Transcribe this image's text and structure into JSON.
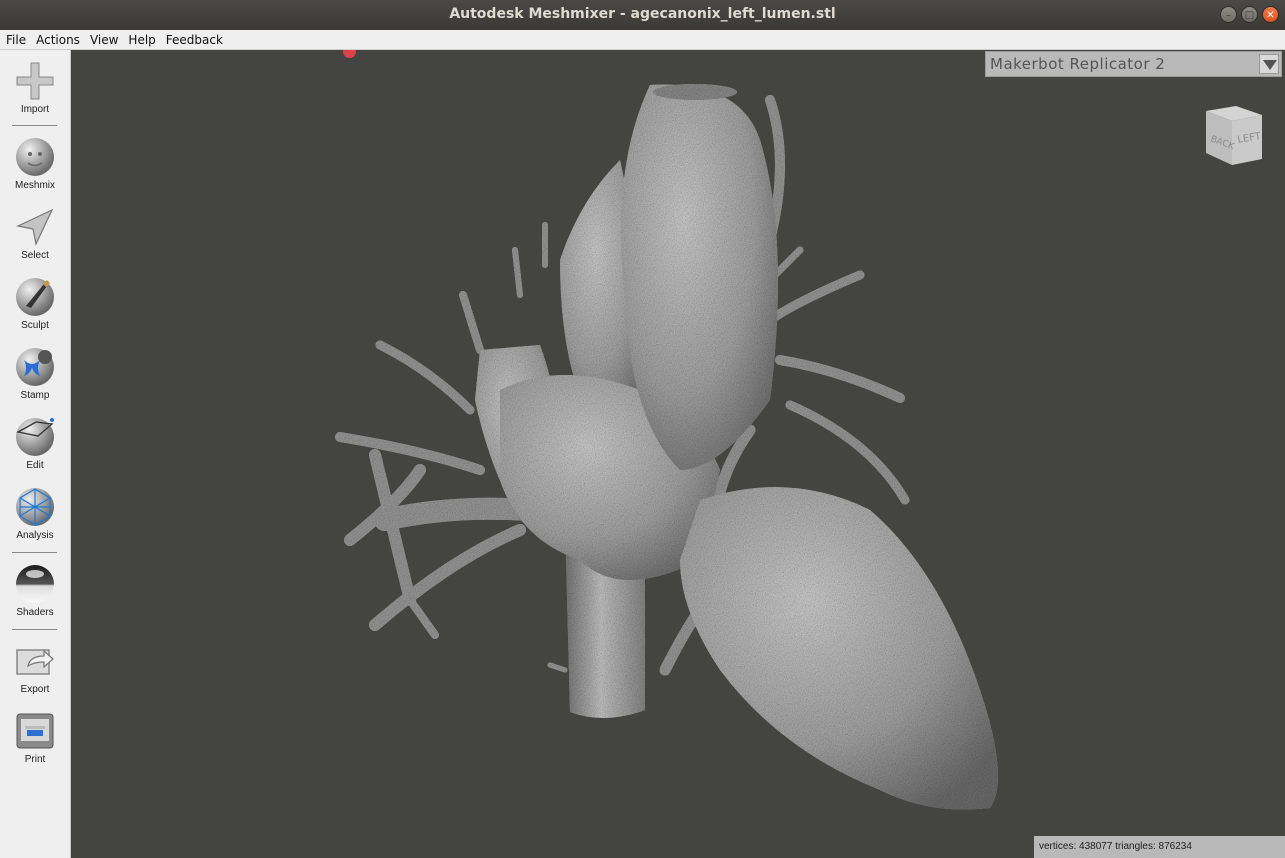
{
  "window": {
    "title": "Autodesk Meshmixer - agecanonix_left_lumen.stl",
    "controls": [
      "minimize",
      "maximize",
      "close"
    ]
  },
  "menu": [
    "File",
    "Actions",
    "View",
    "Help",
    "Feedback"
  ],
  "toolbar": {
    "tools": [
      {
        "label": "Import",
        "icon": "plus-icon"
      },
      {
        "label": "Meshmix",
        "icon": "meshmix-ball-icon"
      },
      {
        "label": "Select",
        "icon": "cursor-arrow-icon"
      },
      {
        "label": "Sculpt",
        "icon": "brush-ball-icon"
      },
      {
        "label": "Stamp",
        "icon": "stamp-ball-icon"
      },
      {
        "label": "Edit",
        "icon": "edit-ball-icon"
      },
      {
        "label": "Analysis",
        "icon": "wireframe-ball-icon"
      },
      {
        "label": "Shaders",
        "icon": "chrome-ball-icon"
      },
      {
        "label": "Export",
        "icon": "export-icon"
      },
      {
        "label": "Print",
        "icon": "printer-icon"
      }
    ]
  },
  "viewport": {
    "printer_select": "Makerbot Replicator 2",
    "navcube": {
      "faces": [
        "BACK",
        "LEFT"
      ]
    },
    "stats": "vertices: 438077 triangles: 876234",
    "model": "heart-left-lumen-mesh"
  },
  "colors": {
    "viewport_bg": "#444443",
    "mesh": "#a9a9a9",
    "titlebar": "#3c3b37",
    "close_button": "#e9541f"
  }
}
